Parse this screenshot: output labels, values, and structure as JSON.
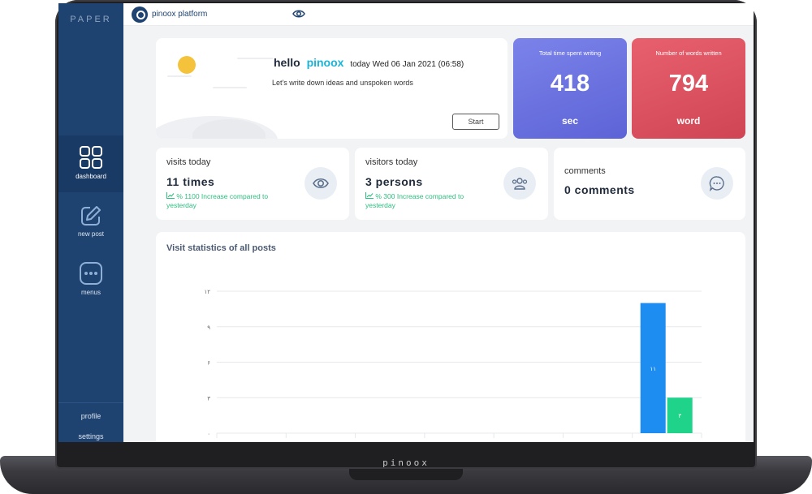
{
  "device": {
    "brand": "pinoox"
  },
  "sidebar": {
    "logo": "PAPER",
    "items": [
      {
        "label": "dashboard",
        "icon": "grid-icon",
        "active": true
      },
      {
        "label": "new post",
        "icon": "edit-icon",
        "active": false
      },
      {
        "label": "menus",
        "icon": "dots-square-icon",
        "active": false
      }
    ],
    "profile": "profile",
    "settings": "settings"
  },
  "topbar": {
    "platform": "pinoox platform",
    "eye_icon": "eye-icon"
  },
  "hello": {
    "greeting": "hello",
    "username": "pinoox",
    "date": "today Wed 06 Jan 2021 (06:58)",
    "subtitle": "Let's write down ideas and unspoken words",
    "start": "Start"
  },
  "stats": {
    "time": {
      "title": "Total time spent writing",
      "value": "418",
      "unit": "sec"
    },
    "words": {
      "title": "Number of words written",
      "value": "794",
      "unit": "word"
    }
  },
  "visits": {
    "label": "visits today",
    "value": "11 times",
    "trend": "% 1100 Increase compared to yesterday",
    "icon": "eye-icon"
  },
  "visitors": {
    "label": "visitors today",
    "value": "3 persons",
    "trend": "% 300 Increase compared to yesterday",
    "icon": "users-icon"
  },
  "comments": {
    "label": "comments",
    "value": "0 comments",
    "icon": "chat-bubble-icon"
  },
  "colors": {
    "sidebar": "#1f4371",
    "accent": "#19b4d8",
    "purple": "#6a70e0",
    "red": "#dc5361",
    "bar_blue": "#1e8df2",
    "bar_green": "#1fd38a",
    "trend": "#2bbd7e"
  },
  "chart_data": {
    "type": "bar",
    "title": "Visit statistics of all posts",
    "y_ticks": [
      "۰",
      "۳",
      "۶",
      "۹",
      "۱۲"
    ],
    "ylim": [
      0,
      12
    ],
    "grid": true,
    "series": [
      {
        "values": [
          11
        ],
        "color": "#1e8df2",
        "label": "۱۱"
      },
      {
        "values": [
          3
        ],
        "color": "#1fd38a",
        "label": "۳"
      }
    ]
  }
}
